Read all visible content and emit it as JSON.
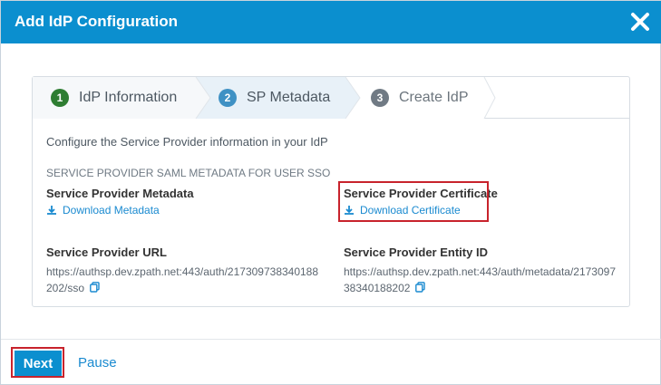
{
  "dialog": {
    "title": "Add IdP Configuration",
    "close_icon": "close-icon"
  },
  "wizard": {
    "steps": [
      {
        "number": "1",
        "label": "IdP Information",
        "state": "completed"
      },
      {
        "number": "2",
        "label": "SP Metadata",
        "state": "active"
      },
      {
        "number": "3",
        "label": "Create IdP",
        "state": "pending"
      }
    ]
  },
  "content": {
    "intro": "Configure the Service Provider information in your IdP",
    "section_heading": "SERVICE PROVIDER SAML METADATA FOR USER SSO",
    "metadata": {
      "label": "Service Provider Metadata",
      "link": "Download Metadata"
    },
    "certificate": {
      "label": "Service Provider Certificate",
      "link": "Download Certificate"
    },
    "sp_url": {
      "label": "Service Provider URL",
      "value": "https://authsp.dev.zpath.net:443/auth/217309738340188202/sso"
    },
    "entity_id": {
      "label": "Service Provider Entity ID",
      "value": "https://authsp.dev.zpath.net:443/auth/metadata/217309738340188202"
    }
  },
  "footer": {
    "next_label": "Next",
    "pause_label": "Pause"
  },
  "colors": {
    "header": "#0b8fcf",
    "link": "#1a8ad0",
    "highlight": "#c8232c",
    "step_complete": "#2e7d32",
    "step_active": "#3f91c4"
  }
}
